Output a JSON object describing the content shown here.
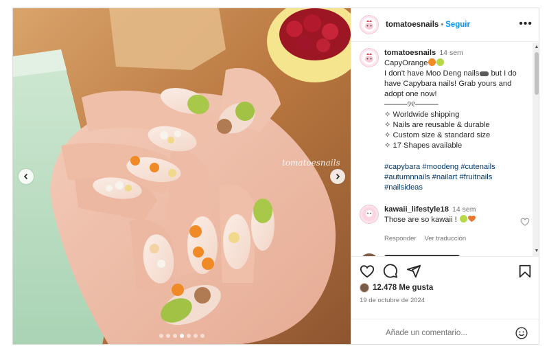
{
  "post": {
    "username": "tomatoesnails",
    "separator": "•",
    "follow_label": "Seguir",
    "more_label": "•••",
    "watermark": "tomatoesnails",
    "carousel": {
      "total": 7,
      "active": 3
    }
  },
  "caption": {
    "username": "tomatoesnails",
    "time": "14 sem",
    "lines": [
      "CapyOrange",
      "I don't have Moo Deng nails",
      " but I do have Capybara nails! Grab yours and adopt one now!",
      "———୨୧———",
      "✧ Worldwide shipping",
      "✧ Nails are reusable & durable",
      "✧ Custom size & standard size",
      "✧ 17 Shapes available"
    ],
    "hashtags": "#capybara #moodeng #cutenails #autumnnails #nailart #fruitnails #nailsideas"
  },
  "comments": [
    {
      "username": "kawaii_lifestyle18",
      "time": "14 sem",
      "text": "Those are so kawaii !",
      "reply_label": "Responder",
      "translate_label": "Ver traducción"
    }
  ],
  "actions": {
    "likes": "12.478 Me gusta",
    "date": "19 de octubre de 2024",
    "comment_placeholder": "Añade un comentario..."
  },
  "icons": {
    "like": "heart-icon",
    "comment": "comment-icon",
    "share": "paper-plane-icon",
    "save": "bookmark-icon",
    "emoji": "smiley-icon"
  },
  "colors": {
    "follow": "#0095f6",
    "hashtag": "#00376b",
    "muted": "#737373",
    "heart_orange": "#e8772e"
  }
}
